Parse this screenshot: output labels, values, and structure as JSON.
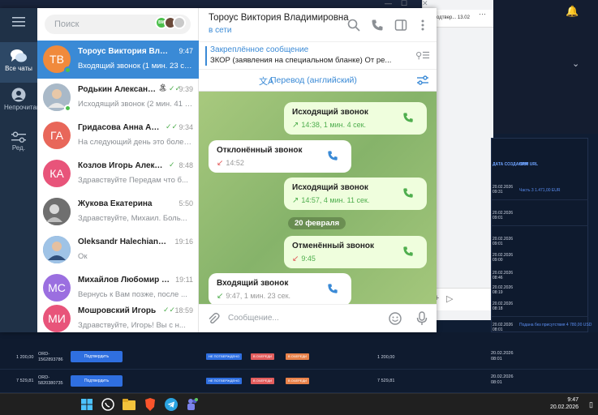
{
  "background": {
    "browser_strip_text": "одтвер... 13.02",
    "browser_menu": "···",
    "table_headers": [
      "ДАТА СОЗДАНИЯ",
      "CRM URL"
    ],
    "side_rows": [
      {
        "date": "20.02.2026",
        "time": "09:31",
        "link": "Часть 3 1.471,00 EUR"
      },
      {
        "date": "20.02.2026",
        "time": "09:01",
        "link": ""
      },
      {
        "date": "20.02.2026",
        "time": "09:01",
        "link": ""
      },
      {
        "date": "20.02.2026",
        "time": "09:00",
        "link": ""
      },
      {
        "date": "20.02.2026",
        "time": "08:46",
        "link": ""
      },
      {
        "date": "20.02.2026",
        "time": "08:19",
        "link": ""
      },
      {
        "date": "20.02.2026",
        "time": "08:18",
        "link": ""
      },
      {
        "date": "20.02.2026",
        "time": "08:01",
        "link": "Подана без присутствия 4 780,00 USD"
      }
    ],
    "rows": [
      {
        "amount": "1 200,00",
        "id": "ORD-1562893786",
        "button": "Подтвердить",
        "tags": [
          "НЕ ПОТВЕРЖДЕНО",
          "В ОЧЕРЕДИ",
          "В ОЧЕРЕДИ"
        ],
        "amount2": "1 200,00",
        "date": "20.02.2026",
        "time": "08:01"
      },
      {
        "amount": "7 529,81",
        "id": "ORD-5820380735",
        "button": "Подтвердить",
        "tags": [
          "НЕ ПОТВЕРЖДЕНО",
          "В ОЧЕРЕДИ",
          "В ОЧЕРЕДИ"
        ],
        "amount2": "7 529,81",
        "date": "20.02.2026",
        "time": "08:01"
      }
    ],
    "row0_amount_partial": "9,00"
  },
  "taskbar": {
    "time": "9:47",
    "date": "20.02.2026"
  },
  "rail": {
    "items": [
      {
        "label": "Все чаты"
      },
      {
        "label": "Непрочитано"
      },
      {
        "label": "Ред."
      }
    ]
  },
  "search": {
    "placeholder": "Поиск",
    "avatar_label": "ВМ"
  },
  "chats": [
    {
      "initials": "ТВ",
      "name": "Тороус Виктория Влади...",
      "time": "9:47",
      "preview": "Входящий звонок (1 мин. 23 сек.)",
      "color": "#f08a3c",
      "active": true,
      "online": true
    },
    {
      "initials": "",
      "name": "Родькин Александ...",
      "time": "9:39",
      "preview": "Исходящий звонок (2 мин. 41 сек.)",
      "color": "#9fb0bf",
      "active": false,
      "online": true,
      "badge": "🏝",
      "check": true
    },
    {
      "initials": "ГА",
      "name": "Гридасова Анна Але...",
      "time": "9:34",
      "preview": "На следующий день это более...",
      "color": "#e8675a",
      "active": false,
      "check": true
    },
    {
      "initials": "КА",
      "name": "Козлов Игорь Алекс...",
      "time": "8:48",
      "preview": "Здравствуйте Передам что б...",
      "color": "#e8547a",
      "active": false,
      "check": true
    },
    {
      "initials": "",
      "name": "Жукова Екатерина",
      "time": "5:50",
      "preview": "Здравствуйте, Михаил. Боль...",
      "color": "#7a7a7a",
      "active": false
    },
    {
      "initials": "",
      "name": "Oleksandr Halechian",
      "time": "19:16",
      "preview": "Ок",
      "color": "#4f7fb8",
      "active": false,
      "verified": true
    },
    {
      "initials": "МС",
      "name": "Михайлов Любомир с...",
      "time": "19:11",
      "preview": "Вернусь к Вам позже, после ...",
      "color": "#9b6fe0",
      "active": false
    },
    {
      "initials": "МИ",
      "name": "Мошровский Игорь",
      "time": "18:59",
      "preview": "Здравствуйте, Игорь! Вы с н...",
      "color": "#e8547a",
      "active": false,
      "check": true
    }
  ],
  "conversation": {
    "name": "Тороус Виктория Владимировна",
    "status": "в сети",
    "pinned_title": "Закреплённое сообщение",
    "pinned_text": "ЗКОР (заявления на специальном бланке)  От ре...",
    "translate": "Перевод (английский)",
    "date_separator": "20 февраля",
    "compose_placeholder": "Сообщение...",
    "messages": [
      {
        "dir": "out",
        "title": "Исходящий звонок",
        "sub": "14:38, 1 мин. 4 сек.",
        "kind": "ok"
      },
      {
        "dir": "in",
        "title": "Отклонённый звонок",
        "sub": "14:52",
        "kind": "missed"
      },
      {
        "dir": "out",
        "title": "Исходящий звонок",
        "sub": "14:57, 4 мин. 11 сек.",
        "kind": "ok"
      },
      {
        "dir": "out",
        "title": "Отменённый звонок",
        "sub": "9:45",
        "kind": "cancel"
      },
      {
        "dir": "in",
        "title": "Входящий звонок",
        "sub": "9:47, 1 мин. 23 сек.",
        "kind": "in"
      }
    ]
  },
  "window_controls": [
    "—",
    "☐",
    "✕"
  ]
}
